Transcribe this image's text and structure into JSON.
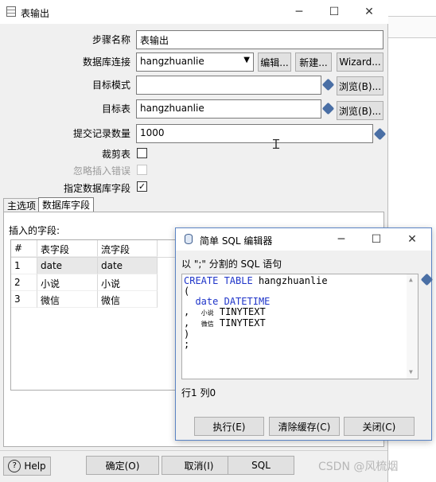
{
  "main_window": {
    "title": "表输出",
    "labels": {
      "step_name": "步骤名称",
      "db_conn": "数据库连接",
      "target_schema": "目标模式",
      "target_table": "目标表",
      "commit_size": "提交记录数量",
      "truncate": "裁剪表",
      "ignore_errors": "忽略插入错误",
      "specify_fields": "指定数据库字段"
    },
    "values": {
      "step_name": "表输出",
      "db_conn": "hangzhuanlie",
      "target_schema": "",
      "target_table": "hangzhuanlie",
      "commit_size": "1000"
    },
    "checks": {
      "truncate": false,
      "ignore_errors": false,
      "specify_fields": true
    },
    "buttons": {
      "edit": "编辑...",
      "new": "新建...",
      "wizard": "Wizard...",
      "browse_schema": "浏览(B)...",
      "browse_table": "浏览(B)..."
    },
    "tabs": [
      "主选项",
      "数据库字段"
    ],
    "insert_fields_label": "插入的字段:",
    "table": {
      "headers": [
        "#",
        "表字段",
        "流字段"
      ],
      "rows": [
        [
          "1",
          "date",
          "date"
        ],
        [
          "2",
          "小说",
          "小说"
        ],
        [
          "3",
          "微信",
          "微信"
        ]
      ]
    },
    "bottom_buttons": {
      "help": "Help",
      "ok": "确定(O)",
      "cancel": "取消(I)",
      "sql": "SQL"
    }
  },
  "sql_dialog": {
    "title": "简单 SQL 编辑器",
    "subtitle": "以 \";\" 分割的 SQL 语句",
    "sql": {
      "line1_kw": "CREATE TABLE",
      "line1_name": "hangzhuanlie",
      "line2": "(",
      "line3_col": "date",
      "line3_type": "DATETIME",
      "line4_prefix": ",",
      "line4_col": "小说",
      "line4_type": "TINYTEXT",
      "line5_prefix": ",",
      "line5_col": "微信",
      "line5_type": "TINYTEXT",
      "line6": ")",
      "line7": ";"
    },
    "cursor_pos": "行1 列0",
    "buttons": {
      "execute": "执行(E)",
      "clear_cache": "清除缓存(C)",
      "close": "关闭(C)"
    }
  },
  "watermark": "CSDN @风梳烟",
  "colors": {
    "keyword": "#1f35c9",
    "dialog_border": "#5b84c4",
    "variable_icon": "#4a6fa5"
  }
}
